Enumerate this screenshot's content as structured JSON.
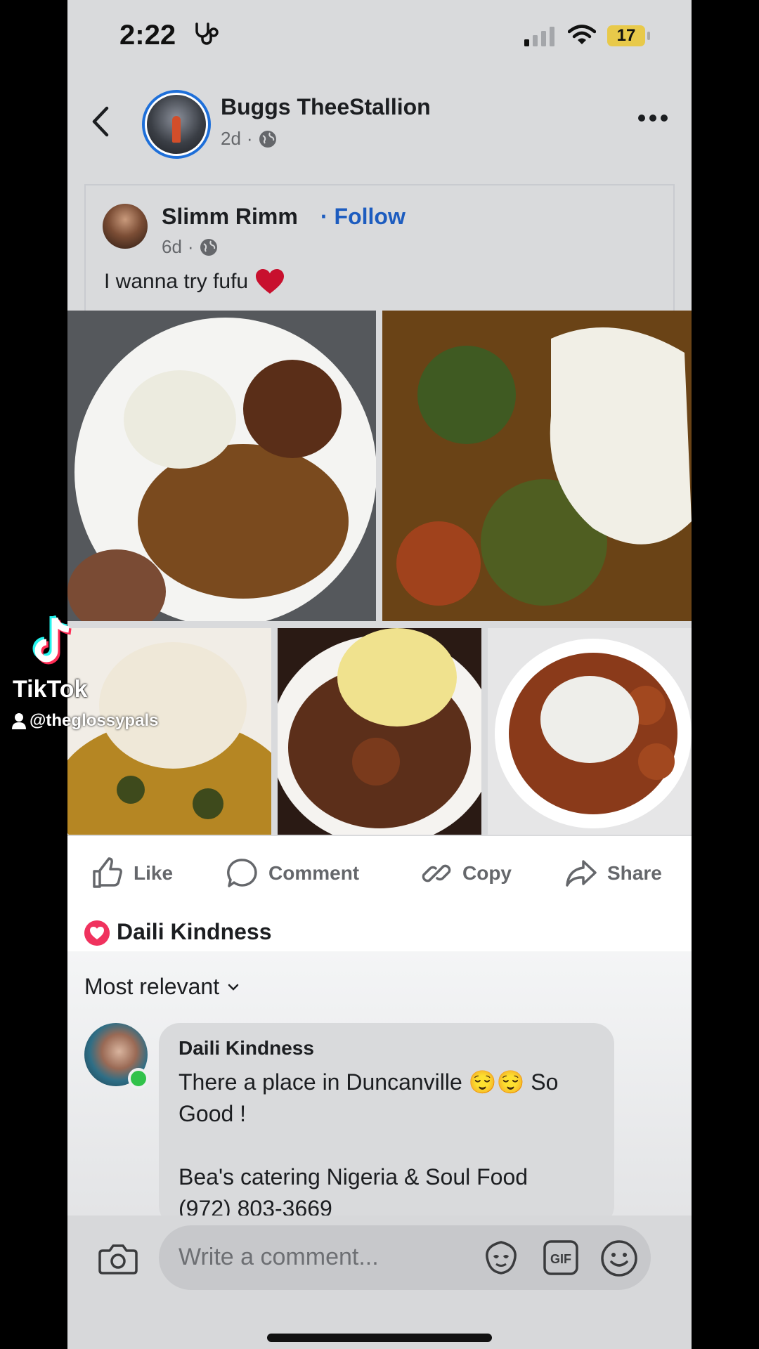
{
  "status_bar": {
    "time": "2:22",
    "battery": "17"
  },
  "header": {
    "author": "Buggs TheeStallion",
    "age": "2d",
    "separator": "·"
  },
  "shared_post": {
    "author": "Slimm Rimm",
    "follow_label": "· Follow",
    "age": "6d",
    "separator": "·",
    "caption": "I wanna try fufu"
  },
  "actions": [
    {
      "label": "Like",
      "icon": "thumbs-up-icon"
    },
    {
      "label": "Comment",
      "icon": "comment-icon"
    },
    {
      "label": "Copy",
      "icon": "link-icon"
    },
    {
      "label": "Share",
      "icon": "share-icon"
    }
  ],
  "reactions": {
    "name": "Daili Kindness",
    "icon": "heart-reaction-icon",
    "color": "#f0325e"
  },
  "comments": {
    "sort_label": "Most relevant",
    "items": [
      {
        "author": "Daili Kindness",
        "text": "There a place in Duncanville 😌😌 So Good !\n\nBea's catering Nigeria & Soul Food\n(972) 803-3669"
      }
    ]
  },
  "composer": {
    "placeholder": "Write a comment..."
  },
  "watermark": {
    "brand": "TikTok",
    "handle": "@theglossypals"
  },
  "colors": {
    "accent": "#1d5cbf",
    "online": "#31c24a"
  }
}
